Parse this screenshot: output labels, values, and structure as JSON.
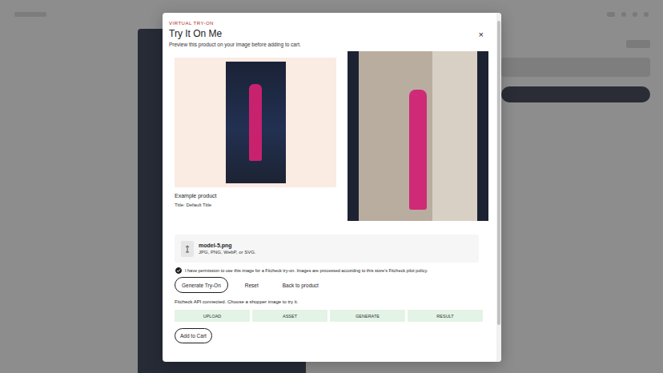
{
  "modal": {
    "eyebrow": "VIRTUAL TRY-ON",
    "title": "Try It On Me",
    "subtitle": "Preview this product on your image before adding to cart.",
    "close": "×"
  },
  "product": {
    "name": "Example product",
    "variant": "Title: Default Title"
  },
  "upload": {
    "file_name": "model-5.png",
    "formats": "JPG, PNG, WebP, or SVG."
  },
  "consent": {
    "checked": true,
    "label": "I have permission to use this image for a Fitcheck try-on. Images are processed according to this store's Fitcheck pilot policy."
  },
  "actions": [
    {
      "label": "Generate Try-On",
      "kind": "outlined"
    },
    {
      "label": "Reset",
      "kind": "text"
    },
    {
      "label": "Back to product",
      "kind": "text"
    }
  ],
  "status": "Fitcheck API connected. Choose a shopper image to try it.",
  "steps": [
    {
      "label": "UPLOAD"
    },
    {
      "label": "ASSET"
    },
    {
      "label": "GENERATE"
    },
    {
      "label": "RESULT"
    }
  ],
  "cart_button": "Add to Cart"
}
